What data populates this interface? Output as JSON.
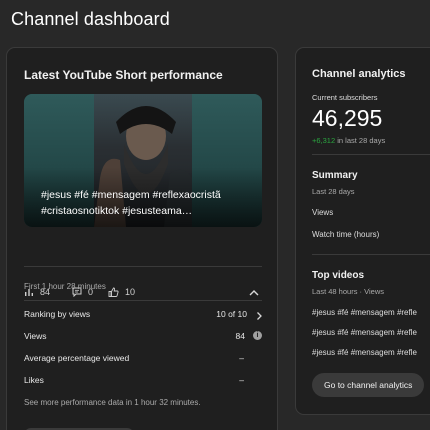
{
  "page": {
    "title": "Channel dashboard"
  },
  "short_card": {
    "title": "Latest YouTube Short performance",
    "caption": "#jesus #fé #mensagem #reflexaocristã #cristaosnotiktok #jesusteama…",
    "stats": {
      "views": "84",
      "comments": "0",
      "likes": "10"
    },
    "period": "First 1 hour 28 minutes",
    "rows": [
      {
        "label": "Ranking by views",
        "value": "10 of 10"
      },
      {
        "label": "Views",
        "value": "84"
      },
      {
        "label": "Average percentage viewed",
        "value": "–"
      },
      {
        "label": "Likes",
        "value": "–"
      }
    ],
    "footer_note": "See more performance data in 1 hour 32 minutes."
  },
  "analytics_card": {
    "title": "Channel analytics",
    "subscribers_label": "Current subscribers",
    "subscribers_value": "46,295",
    "subscribers_change": "+6,312",
    "subscribers_change_period": "in last 28 days",
    "summary_title": "Summary",
    "summary_period": "Last 28 days",
    "summary_items": [
      "Views",
      "Watch time (hours)"
    ],
    "top_videos_title": "Top videos",
    "top_videos_period": "Last 48 hours · Views",
    "top_videos": [
      "#jesus #fé #mensagem #refle",
      "#jesus #fé #mensagem #refle",
      "#jesus #fé #mensagem #refle"
    ],
    "button_label": "Go to channel analytics"
  },
  "colors": {
    "background": "#282828",
    "card": "#1f1f1f",
    "positive": "#2ba640"
  }
}
